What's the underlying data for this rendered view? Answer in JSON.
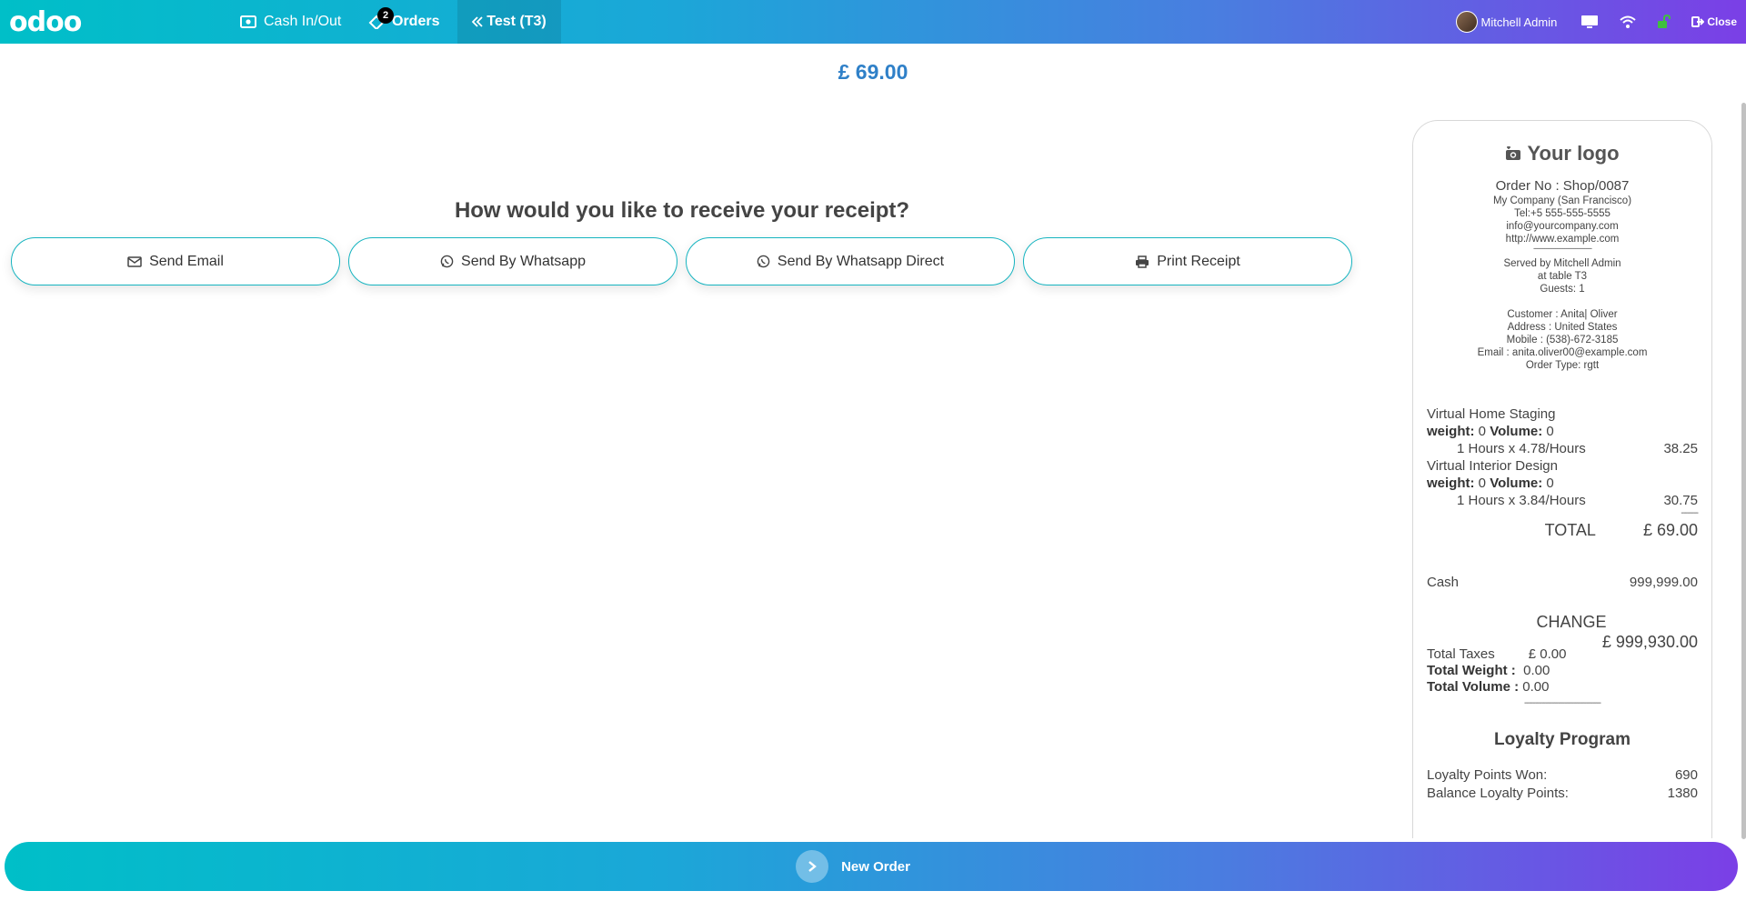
{
  "topbar": {
    "logo": "odoo",
    "cash_label": "Cash In/Out",
    "orders_label": "Orders",
    "orders_badge": "2",
    "table_label": "Test (T3)",
    "user_name": "Mitchell Admin",
    "close_label": "Close"
  },
  "amount": "£ 69.00",
  "receipt_prompt": {
    "question": "How would you like to receive your receipt?",
    "buttons": [
      {
        "label": "Send Email",
        "icon": "envelope-icon"
      },
      {
        "label": "Send By Whatsapp",
        "icon": "whatsapp-icon"
      },
      {
        "label": "Send By Whatsapp Direct",
        "icon": "whatsapp-icon"
      },
      {
        "label": "Print Receipt",
        "icon": "print-icon"
      }
    ]
  },
  "receipt": {
    "logo_text": "Your logo",
    "order_no": "Order No : Shop/0087",
    "company": "My Company (San Francisco)",
    "tel": "Tel:+5 555-555-5555",
    "email": "info@yourcompany.com",
    "website": "http://www.example.com",
    "separator": "--------------------------------",
    "served_by": "Served by Mitchell Admin",
    "table": "at table T3",
    "guests": "Guests: 1",
    "customer": "Customer : Anita| Oliver",
    "address": "Address : United States",
    "mobile": "Mobile : (538)-672-3185",
    "customer_email": "Email : anita.oliver00@example.com",
    "order_type": "Order Type: rgtt",
    "lines": [
      {
        "name": "Virtual Home Staging",
        "weight_label": "weight:",
        "weight": "0",
        "volume_label": "Volume:",
        "volume": "0",
        "qty": "1 Hours x 4.78/Hours",
        "price": "38.25"
      },
      {
        "name": "Virtual Interior Design",
        "weight_label": "weight:",
        "weight": "0",
        "volume_label": "Volume:",
        "volume": "0",
        "qty": "1 Hours x 3.84/Hours",
        "price": "30.75"
      }
    ],
    "line_dash": "--------",
    "total_label": "TOTAL",
    "total_value": "£ 69.00",
    "payment_label": "Cash",
    "payment_value": "999,999.00",
    "change_label": "CHANGE",
    "change_value": "£ 999,930.00",
    "taxes_label": "Total Taxes",
    "taxes_value": "£ 0.00",
    "weight_total_label": "Total Weight :",
    "weight_total_value": "0.00",
    "volume_total_label": "Total Volume :",
    "volume_total_value": "0.00",
    "bottom_dash": "------------------------------------",
    "loyalty_title": "Loyalty Program",
    "points_won_label": "Loyalty Points Won:",
    "points_won_value": "690",
    "balance_label": "Balance Loyalty Points:",
    "balance_value": "1380"
  },
  "bottom": {
    "new_order_label": "New Order"
  }
}
